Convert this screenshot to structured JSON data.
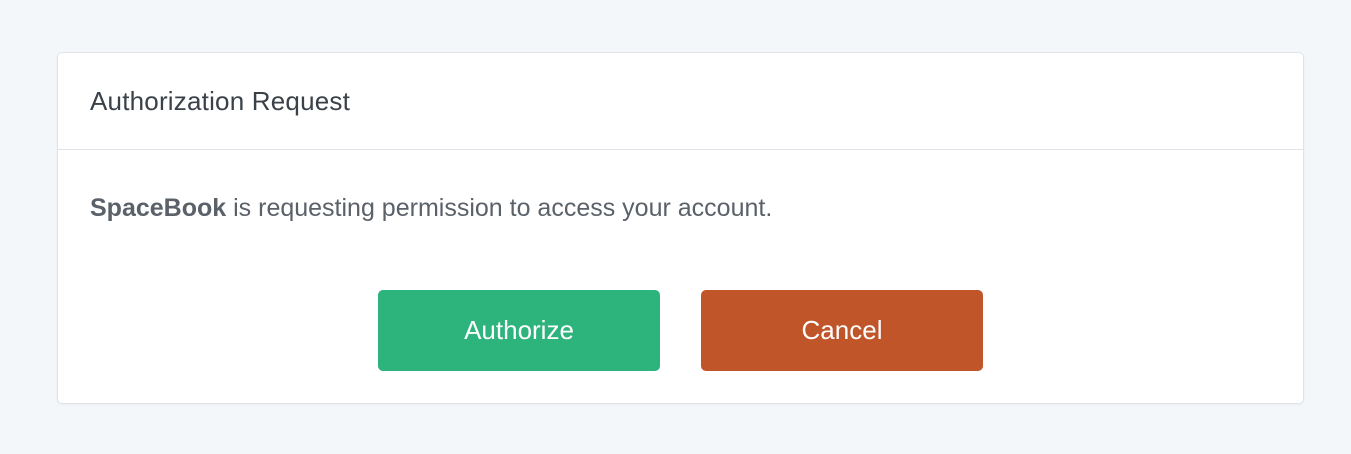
{
  "dialog": {
    "title": "Authorization Request",
    "app_name": "SpaceBook",
    "message": " is requesting permission to access your account.",
    "authorize_label": "Authorize",
    "cancel_label": "Cancel"
  },
  "colors": {
    "page_background": "#f4f7fa",
    "authorize_button": "#2db37c",
    "cancel_button": "#c0552a"
  }
}
